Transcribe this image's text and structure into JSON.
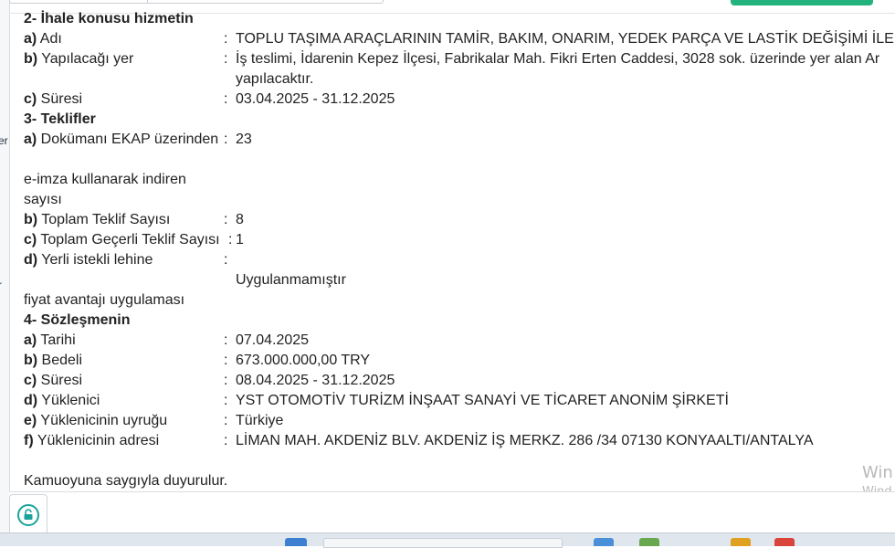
{
  "sections": [
    {
      "id": "s2",
      "heading": "2- İhale konusu hizmetin",
      "rows": [
        {
          "key": "a)",
          "label": " Adı",
          "lines": [
            "TOPLU TAŞIMA ARAÇLARININ TAMİR, BAKIM, ONARIM, YEDEK PARÇA VE LASTİK DEĞİŞİMİ İLE MAN"
          ]
        },
        {
          "key": "b)",
          "label": " Yapılacağı yer",
          "lines": [
            "İş teslimi, İdarenin Kepez İlçesi, Fabrikalar Mah. Fikri Erten Caddesi, 3028 sok. üzerinde yer alan Ar",
            "yapılacaktır."
          ]
        },
        {
          "key": "c)",
          "label": " Süresi",
          "lines": [
            "03.04.2025 - 31.12.2025"
          ]
        }
      ]
    },
    {
      "id": "s3",
      "heading": "3- Teklifler",
      "rows": [
        {
          "key": "a)",
          "label": " Dokümanı EKAP üzerinden",
          "label_lines": [
            "e-imza kullanarak indiren",
            "sayısı"
          ],
          "lines": [
            "23"
          ]
        },
        {
          "key": "b)",
          "label": " Toplam Teklif Sayısı",
          "lines": [
            "8"
          ]
        },
        {
          "key": "c)",
          "label": " Toplam Geçerli Teklif Sayısı",
          "lines": [
            "1"
          ]
        },
        {
          "key": "d)",
          "label": " Yerli istekli lehine",
          "label_lines": [
            "fiyat avantajı uygulaması"
          ],
          "lines": [
            "Uygulanmamıştır"
          ]
        }
      ]
    },
    {
      "id": "s4",
      "heading": "4- Sözleşmenin",
      "rows": [
        {
          "key": "a)",
          "label": " Tarihi",
          "lines": [
            "07.04.2025"
          ]
        },
        {
          "key": "b)",
          "label": " Bedeli",
          "lines": [
            "673.000.000,00 TRY"
          ]
        },
        {
          "key": "c)",
          "label": " Süresi",
          "lines": [
            "08.04.2025 - 31.12.2025"
          ]
        },
        {
          "key": "d)",
          "label": " Yüklenici",
          "lines": [
            "YST OTOMOTİV TURİZM İNŞAAT SANAYİ VE TİCARET ANONİM ŞİRKETİ"
          ]
        },
        {
          "key": "e)",
          "label": " Yüklenicinin uyruğu",
          "lines": [
            "Türkiye"
          ]
        },
        {
          "key": "f)",
          "label": " Yüklenicinin adresi",
          "lines": [
            "LİMAN MAH. AKDENİZ BLV. AKDENİZ İŞ MERKZ. 286 /34 07130 KONYAALTI/ANTALYA"
          ]
        }
      ]
    }
  ],
  "colon": ":",
  "closing": "Kamuoyuna saygıyla duyurulur.",
  "left_strip": {
    "mark1": "er",
    "mark2": "r"
  },
  "watermark": {
    "line1": "Win",
    "line2": "Wind"
  },
  "icons": {
    "lock": "unlock-icon"
  },
  "colors": {
    "accent_green": "#22b37c",
    "lock_teal": "#1aa39a"
  }
}
